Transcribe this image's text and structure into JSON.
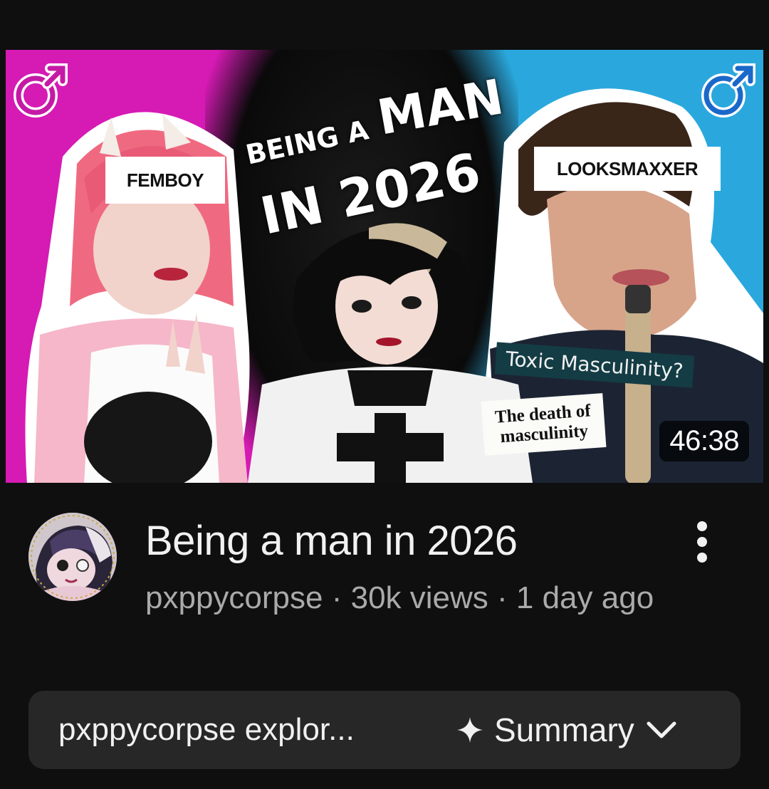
{
  "video": {
    "thumbnail": {
      "duration": "46:38",
      "art_title_line1_small": "BEING A",
      "art_title_line1_big": "MAN",
      "art_title_line2": "IN 2026",
      "label_left": "FEMBOY",
      "label_right": "LOOKSMAXXER",
      "tag_toxic": "Toxic Masculinity?",
      "tag_death_line1": "The death of",
      "tag_death_line2": "masculinity",
      "left_icon": "male-symbol-icon",
      "right_icon": "male-symbol-icon",
      "colors": {
        "left_bg": "#d61ab4",
        "right_bg": "#2aa8dd"
      }
    },
    "title": "Being a man in 2026",
    "channel": "pxppycorpse",
    "views": "30k views",
    "age": "1 day ago",
    "meta_text": "pxppycorpse · 30k views · 1 day ago"
  },
  "summary_bar": {
    "description_preview": "pxppycorpse explor...",
    "summary_label": "Summary",
    "summary_icon": "sparkle-icon",
    "expand_icon": "chevron-down-icon"
  }
}
